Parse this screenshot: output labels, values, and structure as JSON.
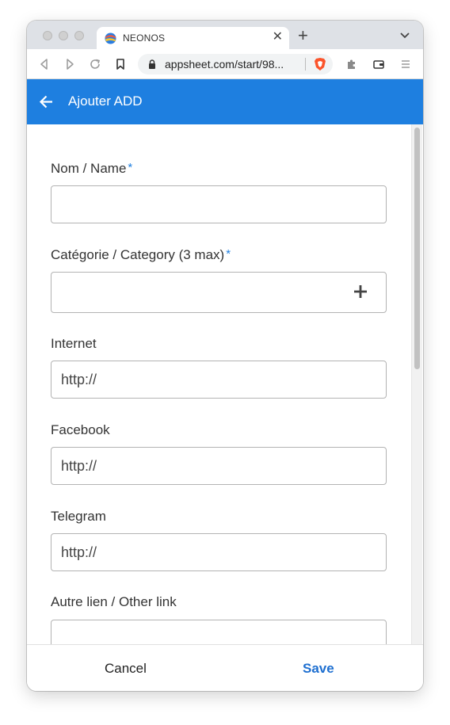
{
  "browser": {
    "tab": {
      "title": "NEONOS",
      "close": "✕"
    },
    "new_tab": "+",
    "url": "appsheet.com/start/98..."
  },
  "appbar": {
    "title": "Ajouter ADD"
  },
  "form": {
    "required_marker": "*",
    "fields": [
      {
        "label": "Nom / Name",
        "value": "",
        "required": true
      },
      {
        "label": "Catégorie / Category (3 max)",
        "value": "",
        "required": true
      },
      {
        "label": "Internet",
        "value": "http://"
      },
      {
        "label": "Facebook",
        "value": "http://"
      },
      {
        "label": "Telegram",
        "value": "http://"
      },
      {
        "label": "Autre lien / Other link",
        "value": ""
      }
    ]
  },
  "footer": {
    "cancel_label": "Cancel",
    "save_label": "Save"
  },
  "colors": {
    "accent": "#1e7fe0",
    "save": "#1e6fd0"
  }
}
